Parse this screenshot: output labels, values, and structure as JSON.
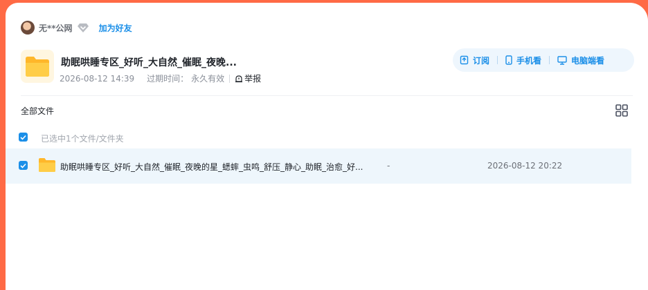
{
  "user": {
    "name": "无**公网",
    "add_friend": "加为好友"
  },
  "share": {
    "title": "助眠哄睡专区_好听_大自然_催眠_夜晚...",
    "date": "2026-08-12 14:39",
    "expire_label": "过期时间：",
    "expire_value": "永久有效",
    "report_label": "举报"
  },
  "actions": {
    "subscribe": "订阅",
    "mobile": "手机看",
    "pc": "电脑端看"
  },
  "breadcrumb": "全部文件",
  "selection": {
    "text": "已选中1个文件/文件夹"
  },
  "files": [
    {
      "name": "助眠哄睡专区_好听_大自然_催眠_夜晚的星_蟋蟀_虫鸣_舒压_静心_助眠_治愈_好...",
      "size": "-",
      "date": "2026-08-12 20:22"
    }
  ],
  "colors": {
    "accent": "#1b8fe8",
    "frame": "#ff6a45",
    "row_selected": "#eef6fc",
    "folder": "#ffc83d"
  },
  "icons": {
    "diamond": "diamond-icon",
    "folder": "folder-icon",
    "report": "alert-icon",
    "subscribe": "subscribe-icon",
    "mobile": "phone-icon",
    "pc": "monitor-icon",
    "grid": "grid-view-icon",
    "check": "checkbox-checked-icon"
  }
}
